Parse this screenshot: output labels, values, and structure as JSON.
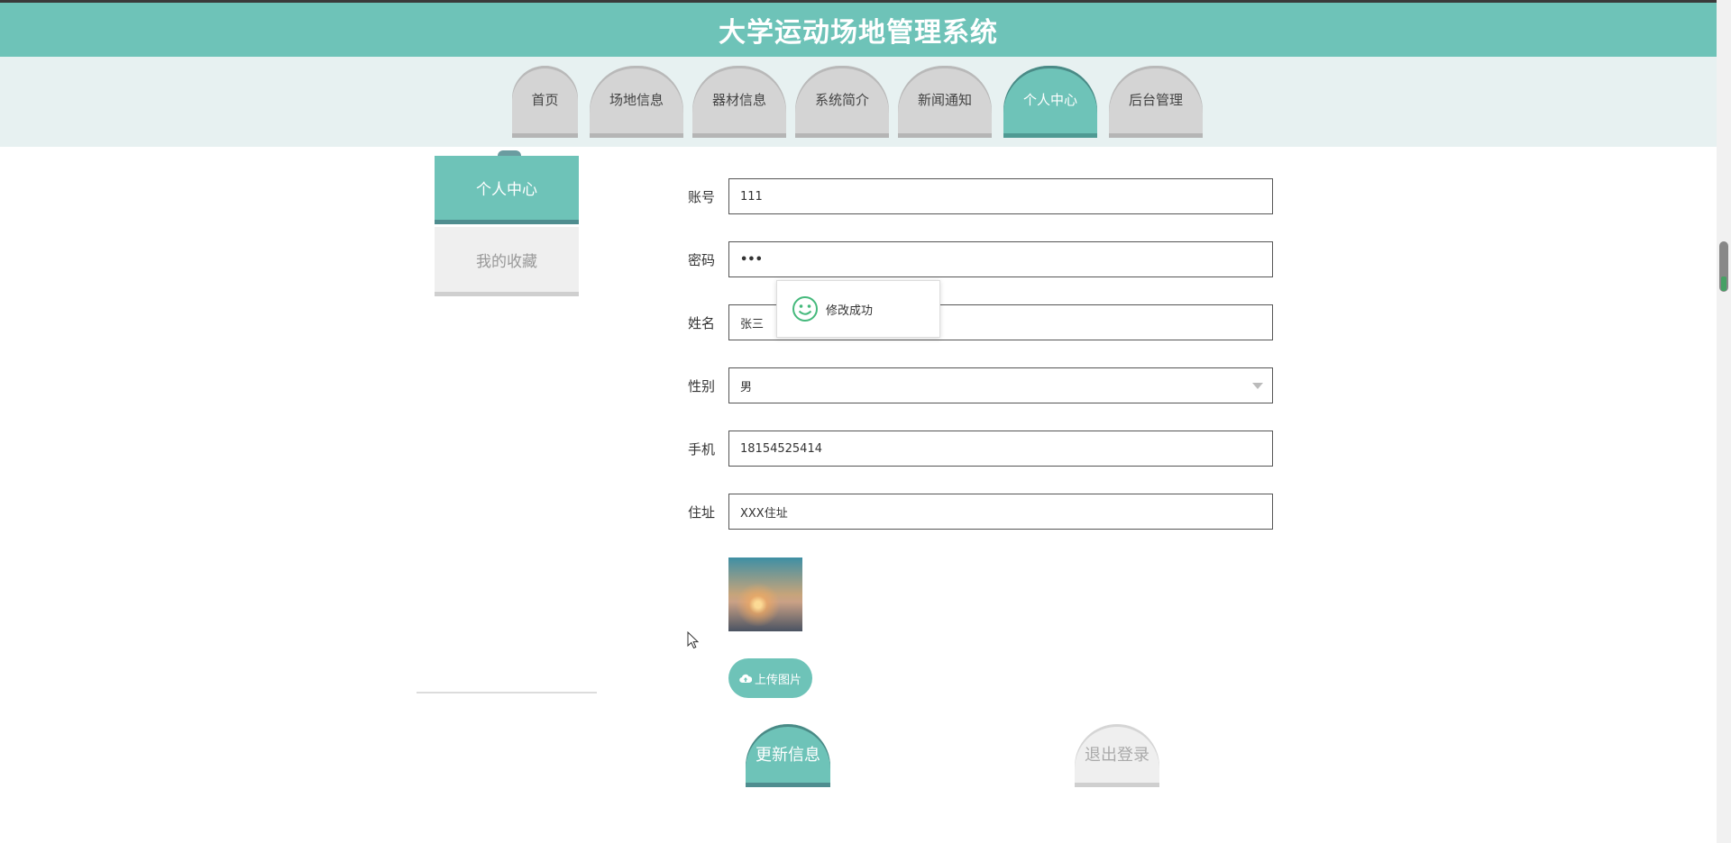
{
  "header": {
    "title": "大学运动场地管理系统"
  },
  "nav": {
    "tabs": [
      {
        "label": "首页"
      },
      {
        "label": "场地信息"
      },
      {
        "label": "器材信息"
      },
      {
        "label": "系统简介"
      },
      {
        "label": "新闻通知"
      },
      {
        "label": "个人中心",
        "active": true
      },
      {
        "label": "后台管理"
      }
    ]
  },
  "sidebar": {
    "items": [
      {
        "label": "个人中心",
        "active": true
      },
      {
        "label": "我的收藏"
      }
    ]
  },
  "form": {
    "account": {
      "label": "账号",
      "value": "111"
    },
    "password": {
      "label": "密码",
      "value": "•••"
    },
    "name": {
      "label": "姓名",
      "value": "张三"
    },
    "gender": {
      "label": "性别",
      "value": "男"
    },
    "phone": {
      "label": "手机",
      "value": "18154525414"
    },
    "address": {
      "label": "住址",
      "value": "XXX住址"
    },
    "upload_label": "上传图片"
  },
  "actions": {
    "update_label": "更新信息",
    "logout_label": "退出登录"
  },
  "toast": {
    "message": "修改成功",
    "icon": "smile-icon"
  },
  "colors": {
    "accent": "#6ec3b8",
    "nav_bg": "#e7f1f1",
    "tab_inactive": "#d4d4d4"
  }
}
